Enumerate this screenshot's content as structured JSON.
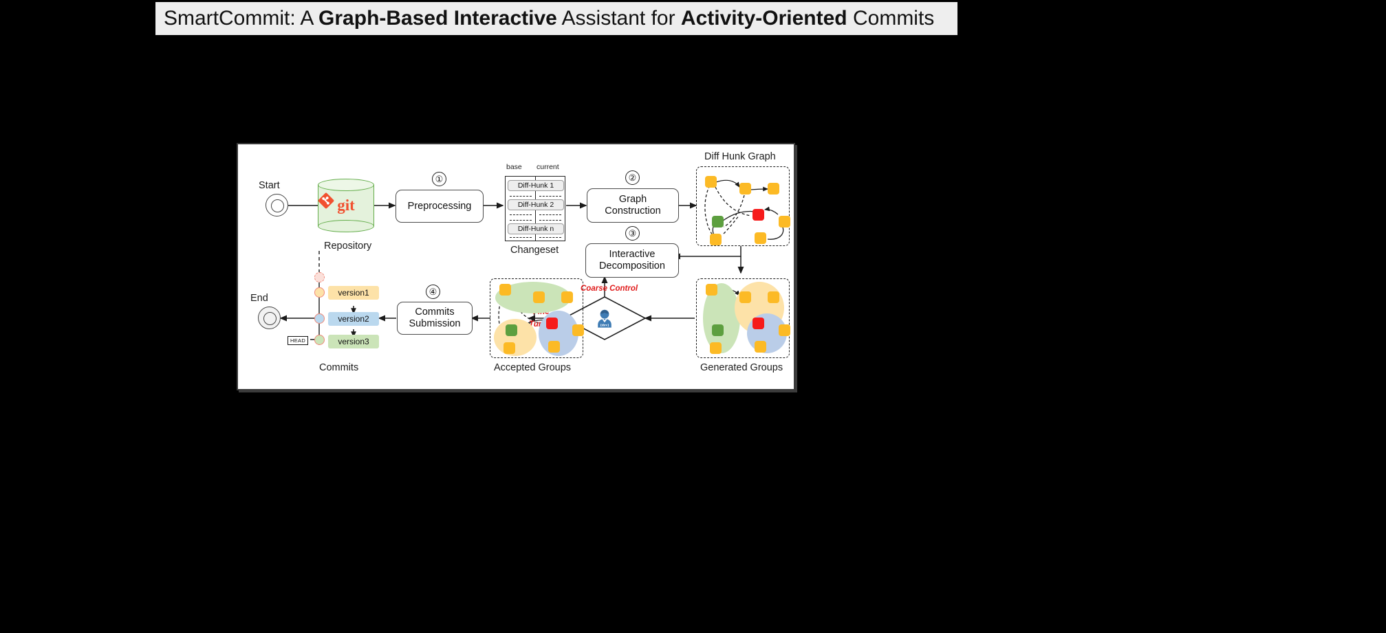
{
  "title": {
    "full": "SmartCommit: A Graph-Based Interactive Assistant for Activity-Oriented Commits",
    "part_plain_1": "SmartCommit: A ",
    "part_bold_1": "Graph-Based Interactive",
    "part_plain_2": " Assistant for ",
    "part_bold_2": "Activity-Oriented",
    "part_plain_3": " Commits"
  },
  "figure": {
    "terminators": {
      "start": "Start",
      "end": "End"
    },
    "steps": {
      "one": "①",
      "two": "②",
      "three": "③",
      "four": "④"
    },
    "process_boxes": {
      "preprocessing": "Preprocessing",
      "graph_construction_l1": "Graph",
      "graph_construction_l2": "Construction",
      "interactive_decomposition_l1": "Interactive",
      "interactive_decomposition_l2": "Decomposition",
      "commits_submission_l1": "Commits",
      "commits_submission_l2": "Submission"
    },
    "repository": {
      "caption": "Repository",
      "logo_word": "git"
    },
    "changeset": {
      "caption": "Changeset",
      "col_base": "base",
      "col_current": "current",
      "hunks": [
        "Diff-Hunk 1",
        "Diff-Hunk 2",
        "Diff-Hunk n"
      ]
    },
    "diff_hunk_graph": {
      "caption": "Diff Hunk Graph"
    },
    "generated_groups": {
      "caption": "Generated Groups"
    },
    "accepted_groups": {
      "caption": "Accepted Groups"
    },
    "commits": {
      "caption": "Commits",
      "head_tag": "HEAD",
      "versions": [
        "version1",
        "version2",
        "version3"
      ]
    },
    "developer": {
      "avatar_label": "{dev}",
      "coarse_control": "Coarse Control",
      "fine_label_l1": "Fine",
      "fine_label_l2": "Tuning"
    },
    "colors": {
      "node_orange": "#fcba25",
      "node_red": "#f61b1b",
      "node_green": "#5d9f3f",
      "blob_green": "#cbe4b8",
      "blob_yellow": "#fde2a8",
      "blob_blue": "#bacde8",
      "git_orange": "#f1502f",
      "repo_green": "#64ad4b",
      "annotation_red": "#e01b1b",
      "version1": "#fde2a8",
      "version2": "#bad8ee",
      "version3": "#cbe4b8",
      "banner_bg": "#eeeeee"
    }
  }
}
